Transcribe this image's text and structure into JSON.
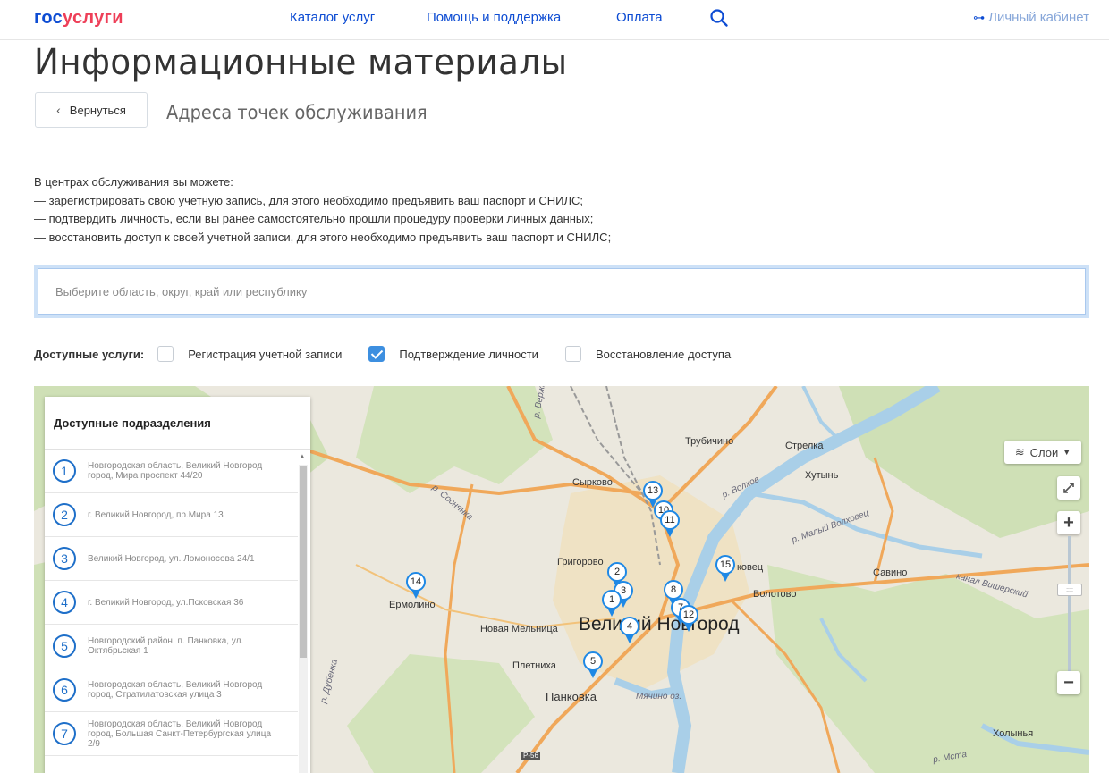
{
  "header": {
    "logo_part1": "гос",
    "logo_part2": "услуги",
    "nav": [
      "Каталог услуг",
      "Помощь и поддержка",
      "Оплата"
    ],
    "cabinet": "Личный кабинет"
  },
  "page": {
    "title": "Информационные материалы",
    "back": "Вернуться",
    "subtitle": "Адреса точек обслуживания"
  },
  "intro": [
    "В центрах обслуживания вы можете:",
    "— зарегистрировать свою учетную запись, для этого необходимо предъявить ваш паспорт и СНИЛС;",
    "— подтвердить личность, если вы ранее самостоятельно прошли процедуру проверки личных данных;",
    "— восстановить доступ к своей учетной записи, для этого необходимо предъявить ваш паспорт и СНИЛС;"
  ],
  "region": {
    "placeholder": "Выберите область, округ, край или республику",
    "value": ""
  },
  "filters": {
    "label": "Доступные услуги:",
    "items": [
      {
        "label": "Регистрация учетной записи",
        "checked": false
      },
      {
        "label": "Подтверждение личности",
        "checked": true
      },
      {
        "label": "Восстановление доступа",
        "checked": false
      }
    ]
  },
  "panel": {
    "title": "Доступные подразделения",
    "items": [
      {
        "num": "1",
        "text": "Новгородская область, Великий Новгород город, Мира проспект 44/20"
      },
      {
        "num": "2",
        "text": "г. Великий Новгород, пр.Мира 13"
      },
      {
        "num": "3",
        "text": "Великий Новгород, ул. Ломоносова 24/1"
      },
      {
        "num": "4",
        "text": "г. Великий Новгород, ул.Псковская 36"
      },
      {
        "num": "5",
        "text": "Новгородский район, п. Панковка, ул. Октябрьская 1"
      },
      {
        "num": "6",
        "text": "Новгородская область, Великий Новгород город, Стратилатовская улица 3"
      },
      {
        "num": "7",
        "text": "Новгородская область, Великий Новгород город, Большая Санкт-Петербургская улица 2/9"
      }
    ]
  },
  "map": {
    "layers_label": "Слои",
    "zoom_in": "+",
    "zoom_out": "−",
    "labels": {
      "city": "Великий Новгород",
      "trubichino": "Трубичино",
      "strelka": "Стрелка",
      "khutyn": "Хутынь",
      "syrkovo": "Сырково",
      "grigorovo": "Григорово",
      "novaya_melnitsa": "Новая Мельница",
      "pletnikha": "Плетниха",
      "pankovka": "Панковка",
      "ermolino": "Ермолино",
      "volotovo": "Волотово",
      "savino": "Савино",
      "khutyn2": "Холынья",
      "kovets": "ковец",
      "r_verzha": "р. Вержа",
      "r_volkhov": "р. Волхов",
      "r_maly_volkhovets": "р. Малый Волховец",
      "r_sosnovka": "р. Соснянка",
      "r_dubenka": "р. Дубенка",
      "kanal": "канал Вишерский",
      "myachino": "Мячино оз.",
      "r56": "Р-56",
      "r_msta": "р. Мста"
    },
    "pins": [
      "13",
      "10",
      "11",
      "2",
      "3",
      "1",
      "4",
      "5",
      "14",
      "8",
      "7",
      "12",
      "15"
    ]
  }
}
